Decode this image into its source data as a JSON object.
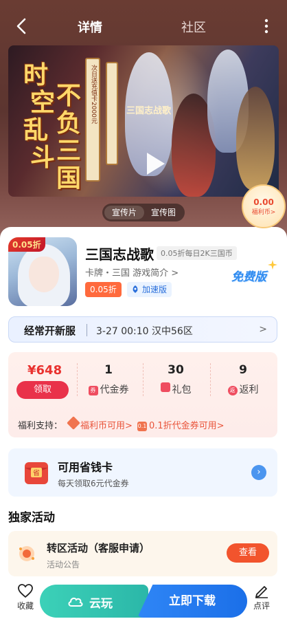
{
  "header": {
    "tabs": [
      {
        "label": "详情"
      },
      {
        "label": "社区"
      }
    ]
  },
  "banner": {
    "slogan": [
      "时",
      "空",
      "乱",
      "斗",
      "不",
      "负",
      "三",
      "国"
    ],
    "scroll_text": "次日送充值卡2000元",
    "logo_text": "三国志战歌",
    "toggle": {
      "video": "宣传片",
      "image": "宣传图"
    }
  },
  "welfare_coin": {
    "amount": "0.00",
    "label": "福利币>"
  },
  "game": {
    "discount_tag": "0.05折",
    "title": "三国志战歌",
    "badge": "0.05折每日2K三国币",
    "meta": "卡牌・三国  游戏简介 >",
    "free_badge": "免费版",
    "chip_discount": "0.05折",
    "chip_speed": "加速版"
  },
  "server": {
    "label": "经常开新服",
    "info": "3-27 00:10 汉中56区",
    "chevron": ">"
  },
  "benefits": {
    "price": "¥648",
    "claim": "领取",
    "items": [
      {
        "num": "1",
        "label": "代金券",
        "icon": "券"
      },
      {
        "num": "30",
        "label": "礼包",
        "icon": "gift"
      },
      {
        "num": "9",
        "label": "返利",
        "icon": "返"
      }
    ],
    "support_label": "福利支持：",
    "support_links": [
      {
        "icon": "coin",
        "text": "福利币可用>"
      },
      {
        "icon": "0.1",
        "text": "0.1折代金券可用>"
      }
    ]
  },
  "saver": {
    "icon_text": "省",
    "title": "可用省钱卡",
    "subtitle": "每天领取6元代金券",
    "arrow": "›"
  },
  "section_title": "独家活动",
  "activity": {
    "title": "转区活动（客服申请）",
    "subtitle": "活动公告",
    "button": "查看"
  },
  "bottom": {
    "favorite": "收藏",
    "cloud_play": "云玩",
    "download": "立即下载",
    "review": "点评"
  },
  "colors": {
    "accent_red": "#e9324a",
    "accent_blue": "#2f86f6",
    "accent_teal": "#3cd1b8"
  }
}
